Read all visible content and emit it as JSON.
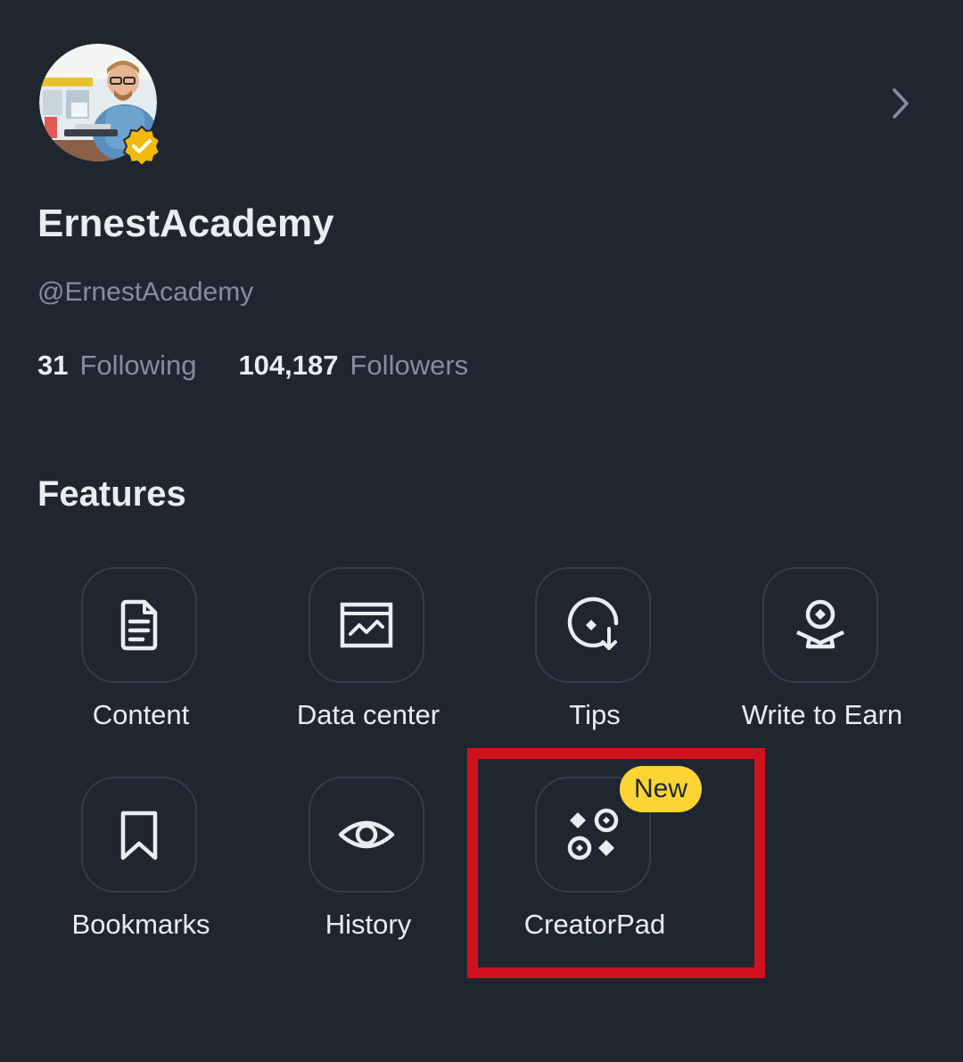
{
  "profile": {
    "name": "ErnestAcademy",
    "handle": "@ErnestAcademy",
    "verified": true,
    "following_count": "31",
    "following_label": "Following",
    "followers_count": "104,187",
    "followers_label": "Followers"
  },
  "features": {
    "title": "Features",
    "items": [
      {
        "label": "Content",
        "icon": "document-icon"
      },
      {
        "label": "Data center",
        "icon": "chart-icon"
      },
      {
        "label": "Tips",
        "icon": "tips-icon"
      },
      {
        "label": "Write to Earn",
        "icon": "write-to-earn-icon"
      },
      {
        "label": "Bookmarks",
        "icon": "bookmark-icon"
      },
      {
        "label": "History",
        "icon": "eye-icon"
      },
      {
        "label": "CreatorPad",
        "icon": "creatorpad-icon",
        "badge": "New"
      }
    ]
  },
  "colors": {
    "background": "#202630",
    "text_primary": "#eaecef",
    "text_secondary": "#848e9c",
    "badge": "#fcd535",
    "highlight": "#d0121f"
  }
}
